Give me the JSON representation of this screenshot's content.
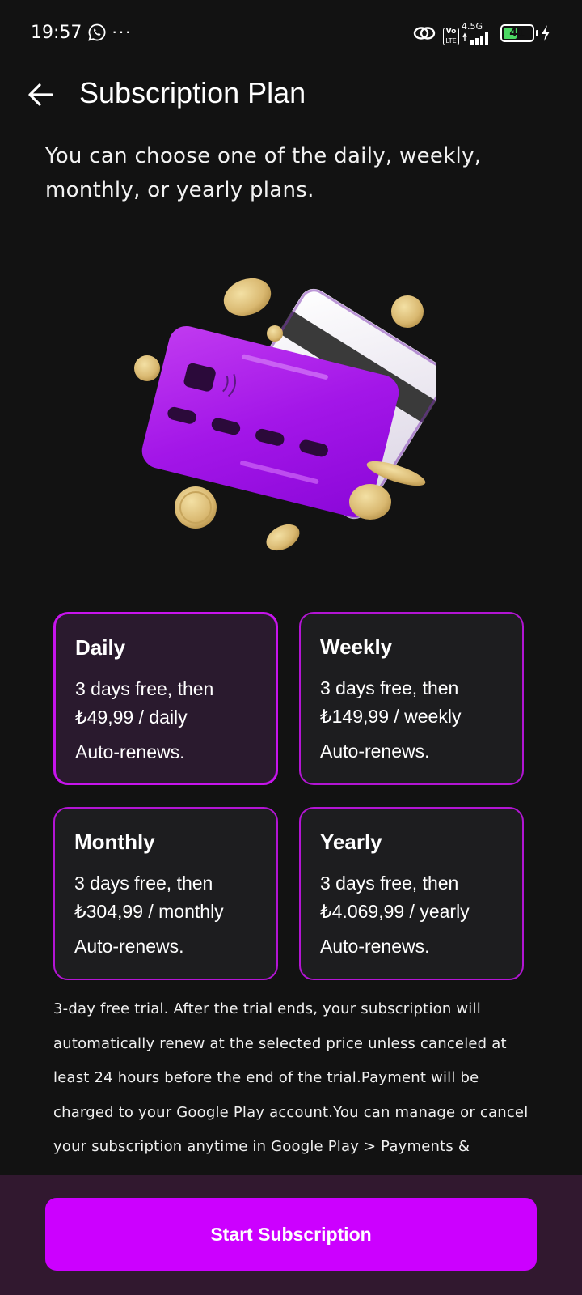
{
  "status_bar": {
    "time": "19:57",
    "dots": "···",
    "network": "4.5G",
    "volte_top": "Vo",
    "volte_bottom": "LTE",
    "battery": "41"
  },
  "header": {
    "title": "Subscription Plan"
  },
  "subtitle": "You can choose one of the daily, weekly, monthly, or yearly plans.",
  "plans": [
    {
      "name": "Daily",
      "trial": "3 days free, then",
      "price": "₺49,99 / daily",
      "renew": "Auto-renews.",
      "selected": true
    },
    {
      "name": "Weekly",
      "trial": "3 days free, then",
      "price": "₺149,99 / weekly",
      "renew": "Auto-renews.",
      "selected": false
    },
    {
      "name": "Monthly",
      "trial": "3 days free, then",
      "price": "₺304,99 / monthly",
      "renew": "Auto-renews.",
      "selected": false
    },
    {
      "name": "Yearly",
      "trial": "3 days free, then",
      "price": "₺4.069,99 / yearly",
      "renew": "Auto-renews.",
      "selected": false
    }
  ],
  "disclaimer": "3-day free trial. After the trial ends, your subscription will automatically renew at the selected price unless canceled at least 24 hours before the end of the trial.Payment will be charged to your Google Play account.You can manage or cancel your subscription anytime in Google Play > Payments &",
  "cta": {
    "label": "Start Subscription"
  },
  "colors": {
    "accent": "#cc00ff",
    "card_border": "#b315d4",
    "background": "#121212",
    "bottom_bar": "#31182f"
  },
  "icons": {
    "back": "arrow-left-icon",
    "whatsapp": "whatsapp-icon",
    "hotspot": "link-icon",
    "signal": "signal-bars-icon",
    "battery": "battery-icon",
    "charging": "lightning-icon"
  }
}
